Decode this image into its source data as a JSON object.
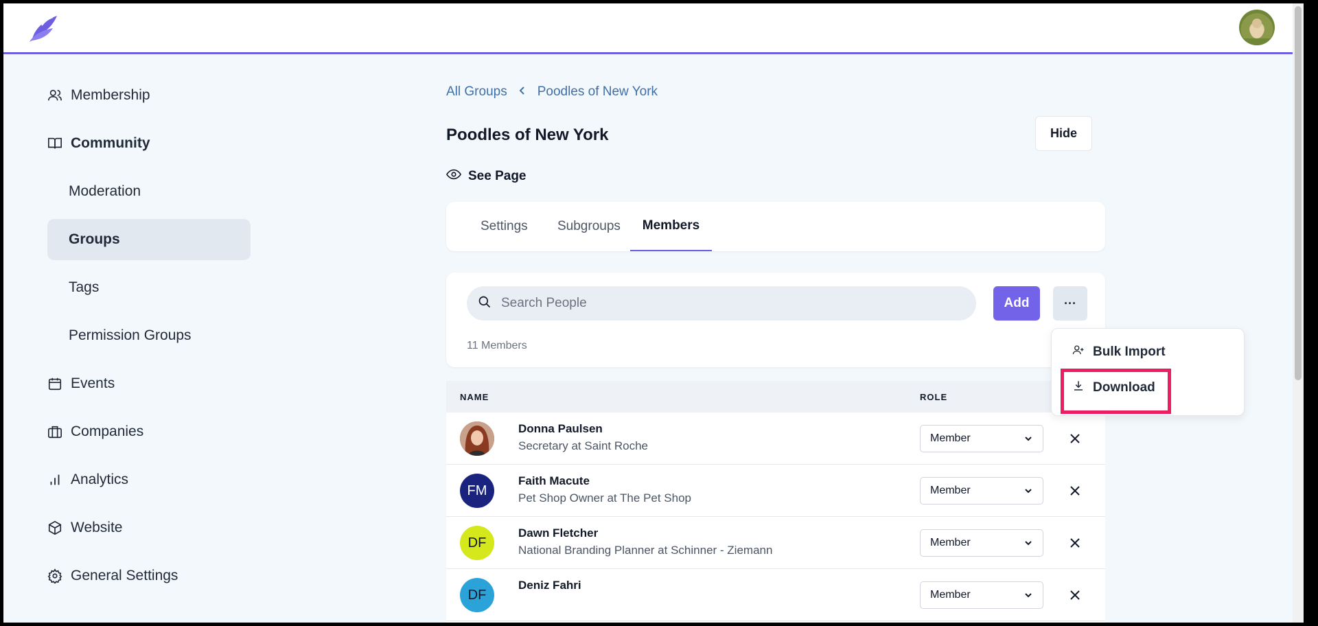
{
  "sidebar": {
    "items": [
      {
        "label": "Membership",
        "icon": "users-icon"
      },
      {
        "label": "Community",
        "icon": "book-icon"
      },
      {
        "label": "Moderation"
      },
      {
        "label": "Groups"
      },
      {
        "label": "Tags"
      },
      {
        "label": "Permission Groups"
      },
      {
        "label": "Events",
        "icon": "calendar-icon"
      },
      {
        "label": "Companies",
        "icon": "briefcase-icon"
      },
      {
        "label": "Analytics",
        "icon": "bar-chart-icon"
      },
      {
        "label": "Website",
        "icon": "cube-icon"
      },
      {
        "label": "General Settings",
        "icon": "gear-icon"
      }
    ]
  },
  "breadcrumb": {
    "root": "All Groups",
    "current": "Poodles of New York"
  },
  "page": {
    "title": "Poodles of New York",
    "hide_label": "Hide",
    "see_page_label": "See Page"
  },
  "tabs": [
    {
      "label": "Settings"
    },
    {
      "label": "Subgroups"
    },
    {
      "label": "Members"
    }
  ],
  "members": {
    "search_placeholder": "Search People",
    "add_label": "Add",
    "more_label": "···",
    "count_label": "11 Members"
  },
  "table": {
    "headers": {
      "name": "NAME",
      "role": "ROLE"
    },
    "rows": [
      {
        "initials": "",
        "name": "Donna Paulsen",
        "title": "Secretary at Saint Roche",
        "role": "Member",
        "avatar_color": "#8a4b3a"
      },
      {
        "initials": "FM",
        "name": "Faith Macute",
        "title": "Pet Shop Owner at The Pet Shop",
        "role": "Member",
        "avatar_color": "#1a237e"
      },
      {
        "initials": "DF",
        "name": "Dawn Fletcher",
        "title": "National Branding Planner at Schinner - Ziemann",
        "role": "Member",
        "avatar_color": "#d4e81c"
      },
      {
        "initials": "DF",
        "name": "Deniz Fahri",
        "title": "",
        "role": "Member",
        "avatar_color": "#2ba3d8"
      }
    ]
  },
  "dropdown": {
    "items": [
      {
        "label": "Bulk Import",
        "icon": "user-plus-icon"
      },
      {
        "label": "Download",
        "icon": "download-icon"
      }
    ]
  },
  "colors": {
    "accent": "#6d5fe0",
    "highlight": "#ec1e62",
    "link": "#3f6fa8"
  }
}
